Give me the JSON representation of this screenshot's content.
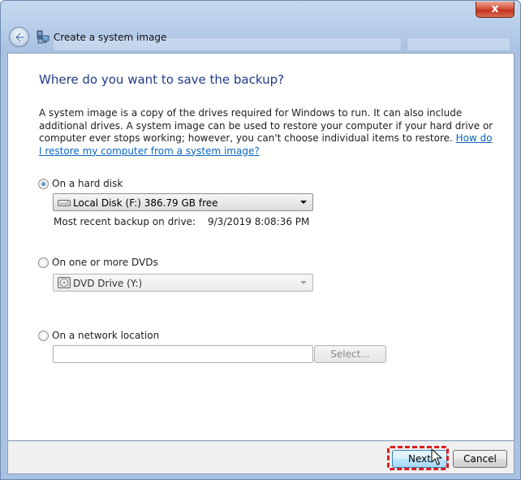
{
  "window": {
    "title": "Create a system image",
    "close_glyph": "x"
  },
  "page": {
    "heading": "Where do you want to save the backup?",
    "description": "A system image is a copy of the drives required for Windows to run. It can also include additional drives. A system image can be used to restore your computer if your hard drive or computer ever stops working; however, you can't choose individual items to restore.",
    "help_link": "How do I restore my computer from a system image?"
  },
  "options": {
    "hard_disk": {
      "label": "On a hard disk",
      "selected": true,
      "drive_value": "Local Disk (F:)  386.79 GB free",
      "recent_label": "Most recent backup on drive:",
      "recent_value": "9/3/2019 8:08:36 PM"
    },
    "dvd": {
      "label": "On one or more DVDs",
      "selected": false,
      "drive_value": "DVD Drive (Y:)"
    },
    "network": {
      "label": "On a network location",
      "selected": false,
      "location_value": "",
      "select_button": "Select..."
    }
  },
  "footer": {
    "next_button": "Next",
    "cancel_button": "Cancel"
  },
  "icons": {
    "back": "back-arrow-icon",
    "title": "system-image-icon",
    "hard_drive": "hard-drive-icon",
    "dvd_drive": "dvd-drive-icon",
    "cursor": "mouse-pointer-icon"
  },
  "colors": {
    "heading": "#1f3a8a",
    "link": "#0a66c2",
    "highlight": "#e01b1b",
    "close_button": "#c3331e"
  }
}
